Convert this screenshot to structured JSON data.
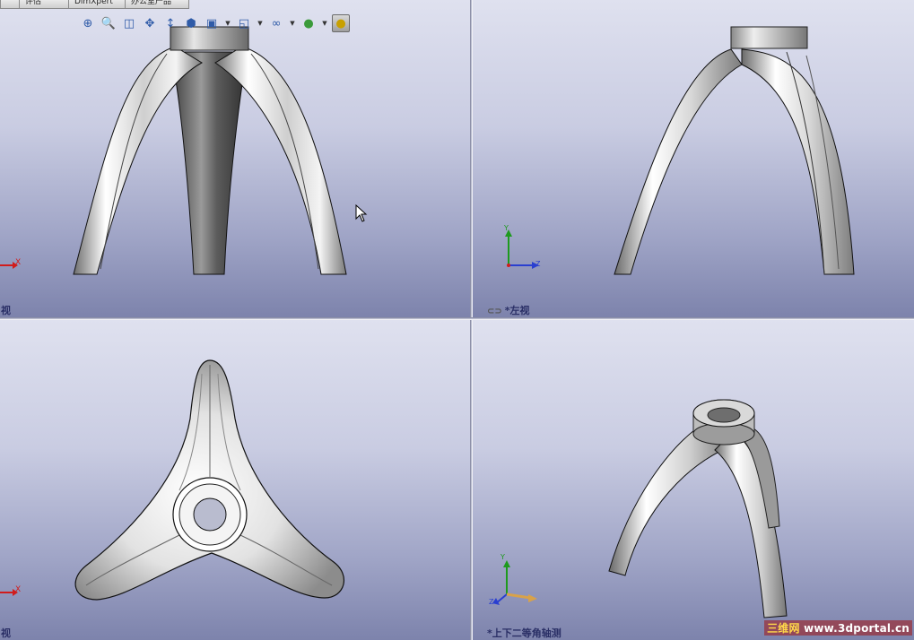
{
  "tabs": [
    "",
    "评估",
    "DimXpert",
    "办公室产品"
  ],
  "toolbar": {
    "items": [
      "zoom-to-fit-icon",
      "zoom-area-icon",
      "previous-view-icon",
      "section-view-icon",
      "view-orientation-icon",
      "display-style-icon",
      "hide-show-items-icon",
      "edit-appearance-icon",
      "apply-scene-icon",
      "view-settings-icon"
    ]
  },
  "viewports": {
    "front": {
      "label": "视",
      "axis": "X"
    },
    "left": {
      "label": "*左视",
      "axes": [
        "Y",
        "Z"
      ]
    },
    "top": {
      "label": "视",
      "axis": "X"
    },
    "iso": {
      "label": "*上下二等角轴测",
      "axes": [
        "Y",
        "Z"
      ]
    }
  },
  "watermark": {
    "cn": "三维网",
    "url": "www.3dportal.cn"
  },
  "colors": {
    "accent_red": "#d11c1c",
    "label_navy": "#2a2f66",
    "axis_green": "#1e9a1e",
    "axis_blue": "#2a3fd0"
  }
}
